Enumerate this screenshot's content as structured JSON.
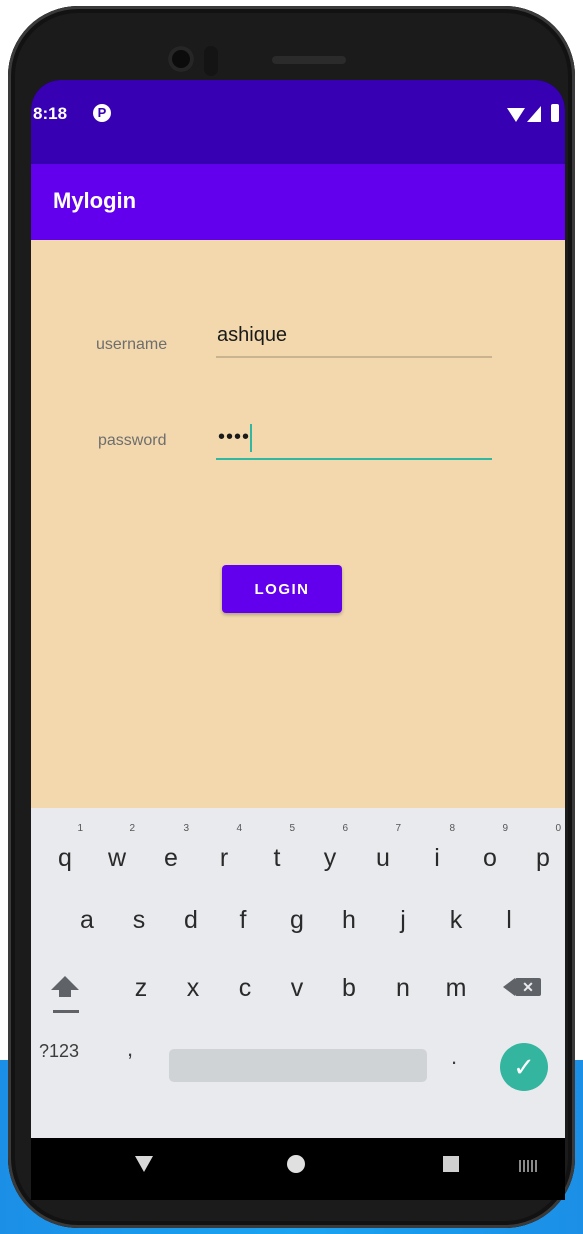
{
  "status_bar": {
    "time": "8:18",
    "badge": "P"
  },
  "app_bar": {
    "title": "Mylogin"
  },
  "form": {
    "username_label": "username",
    "username_value": "ashique",
    "password_label": "password",
    "password_value": "••••",
    "login_label": "LOGIN"
  },
  "keyboard": {
    "row1": [
      {
        "k": "q",
        "h": "1"
      },
      {
        "k": "w",
        "h": "2"
      },
      {
        "k": "e",
        "h": "3"
      },
      {
        "k": "r",
        "h": "4"
      },
      {
        "k": "t",
        "h": "5"
      },
      {
        "k": "y",
        "h": "6"
      },
      {
        "k": "u",
        "h": "7"
      },
      {
        "k": "i",
        "h": "8"
      },
      {
        "k": "o",
        "h": "9"
      },
      {
        "k": "p",
        "h": "0"
      }
    ],
    "row2": [
      "a",
      "s",
      "d",
      "f",
      "g",
      "h",
      "j",
      "k",
      "l"
    ],
    "row3": [
      "z",
      "x",
      "c",
      "v",
      "b",
      "n",
      "m"
    ],
    "symbols_label": "?123",
    "comma": ",",
    "period": ".",
    "enter_icon": "checkmark-icon",
    "backspace_icon": "backspace-icon",
    "shift_icon": "shift-icon"
  },
  "colors": {
    "status_bar": "#3700b3",
    "app_bar": "#6200ee",
    "background": "#f2d8ac",
    "accent": "#31b8a0"
  }
}
